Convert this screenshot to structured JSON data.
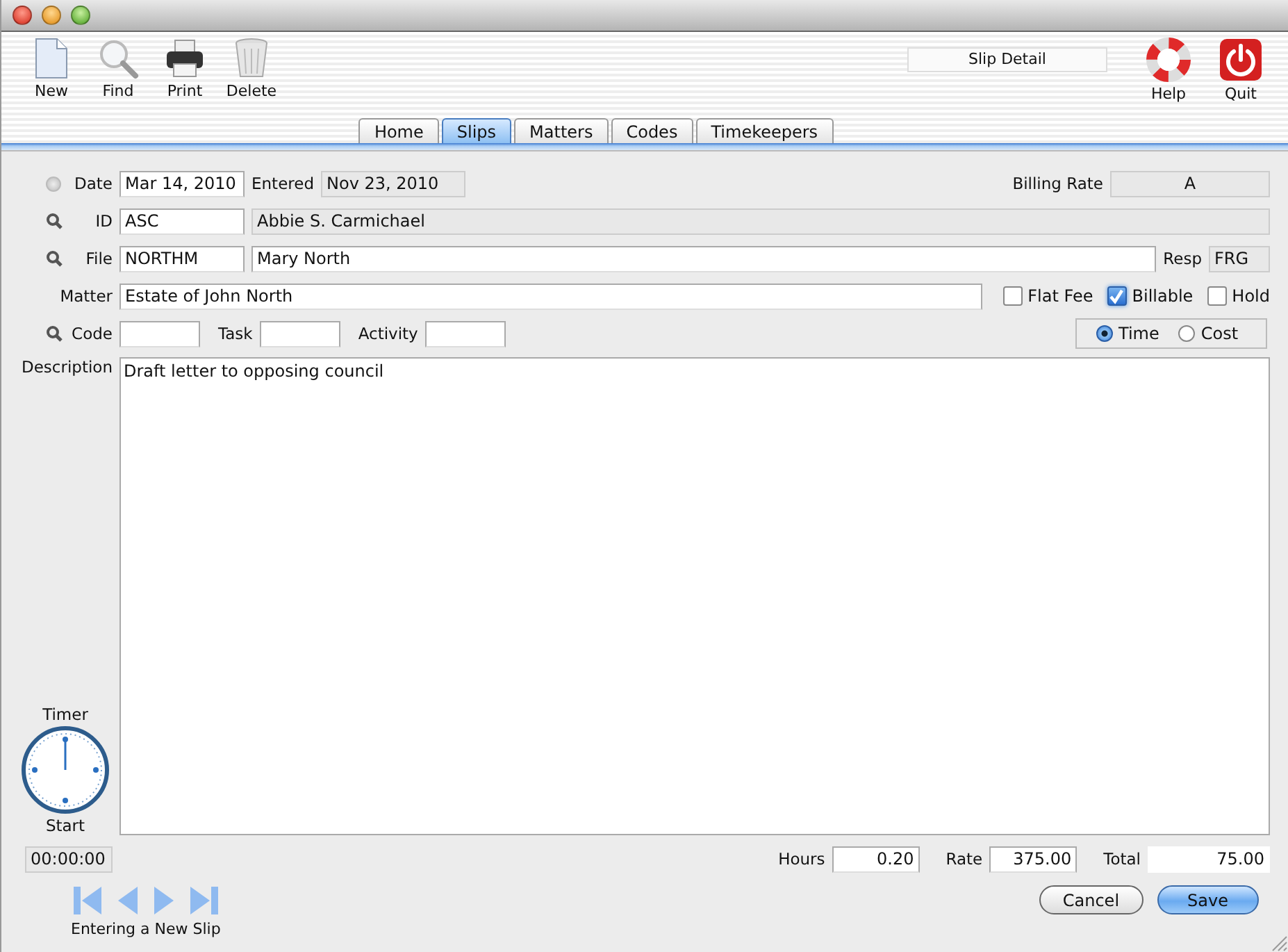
{
  "toolbar": {
    "left": [
      {
        "kind": "new",
        "label": "New"
      },
      {
        "kind": "find",
        "label": "Find"
      },
      {
        "kind": "print",
        "label": "Print"
      },
      {
        "kind": "delete",
        "label": "Delete"
      }
    ],
    "status": "Slip Detail",
    "right": [
      {
        "kind": "help",
        "label": "Help"
      },
      {
        "kind": "quit",
        "label": "Quit"
      }
    ]
  },
  "tabs": [
    {
      "label": "Home",
      "selected": false
    },
    {
      "label": "Slips",
      "selected": true
    },
    {
      "label": "Matters",
      "selected": false
    },
    {
      "label": "Codes",
      "selected": false
    },
    {
      "label": "Timekeepers",
      "selected": false
    }
  ],
  "form": {
    "date": {
      "label": "Date",
      "selected": false,
      "value": "Mar 14, 2010"
    },
    "entered": {
      "label": "Entered",
      "value": "Nov 23, 2010"
    },
    "billing_rate": {
      "label": "Billing Rate",
      "value": "A"
    },
    "id": {
      "label": "ID",
      "value": "ASC",
      "name": "Abbie S. Carmichael"
    },
    "file": {
      "label": "File",
      "value": "NORTHM",
      "name": "Mary North"
    },
    "resp": {
      "label": "Resp",
      "value": "FRG"
    },
    "matter": {
      "label": "Matter",
      "value": "Estate of John North"
    },
    "flags": [
      {
        "label": "Flat Fee",
        "checked": false
      },
      {
        "label": "Billable",
        "checked": true
      },
      {
        "label": "Hold",
        "checked": false
      }
    ],
    "code": {
      "label": "Code"
    },
    "task": {
      "label": "Task"
    },
    "activity": {
      "label": "Activity"
    },
    "slip_type": [
      {
        "label": "Time",
        "selected": true
      },
      {
        "label": "Cost",
        "selected": false
      }
    ],
    "description": {
      "label": "Description",
      "value": "Draft letter to opposing council"
    },
    "timer": {
      "label": "Timer",
      "action": "Start",
      "elapsed": "00:00:00"
    },
    "hours": {
      "label": "Hours",
      "value": "0.20"
    },
    "rate": {
      "label": "Rate",
      "value": "375.00"
    },
    "total": {
      "label": "Total",
      "value": "75.00"
    }
  },
  "navigation": [
    {
      "kind": "first"
    },
    {
      "kind": "previous"
    },
    {
      "kind": "next"
    },
    {
      "kind": "last"
    }
  ],
  "status": "Entering a New Slip",
  "buttons": [
    {
      "label": "Cancel",
      "default": false
    },
    {
      "label": "Save",
      "default": true
    }
  ]
}
